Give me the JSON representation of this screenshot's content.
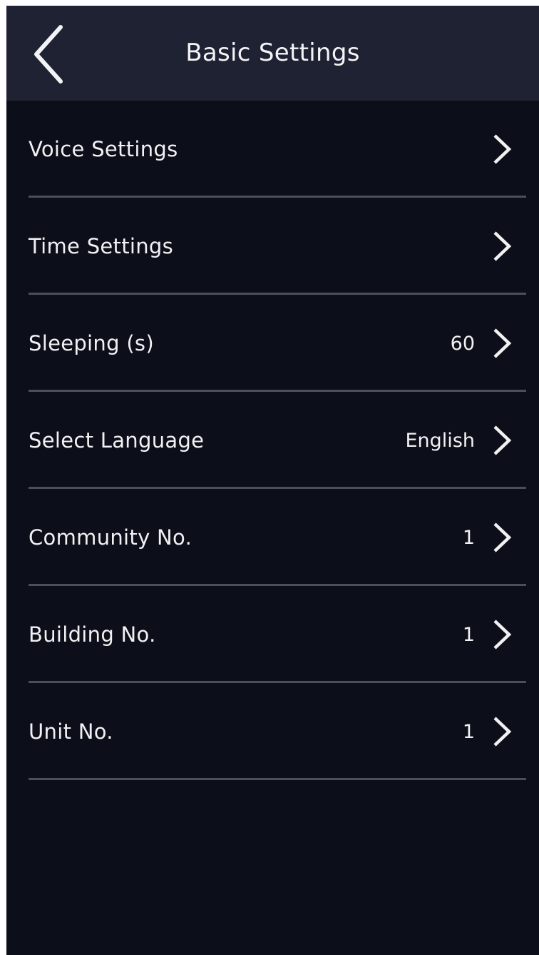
{
  "header": {
    "title": "Basic Settings",
    "back_icon": "chevron-left-icon"
  },
  "menu": {
    "items": [
      {
        "label": "Voice Settings",
        "value": "",
        "icon": "chevron-right-icon"
      },
      {
        "label": "Time Settings",
        "value": "",
        "icon": "chevron-right-icon"
      },
      {
        "label": "Sleeping (s)",
        "value": "60",
        "icon": "chevron-right-icon"
      },
      {
        "label": "Select Language",
        "value": "English",
        "icon": "chevron-right-icon"
      },
      {
        "label": "Community No.",
        "value": "1",
        "icon": "chevron-right-icon"
      },
      {
        "label": "Building No.",
        "value": "1",
        "icon": "chevron-right-icon"
      },
      {
        "label": "Unit No.",
        "value": "1",
        "icon": "chevron-right-icon"
      }
    ]
  },
  "colors": {
    "background": "#0c0f19",
    "header_background": "#1e2233",
    "text": "#f1f1f3",
    "divider": "#4c4f58"
  }
}
